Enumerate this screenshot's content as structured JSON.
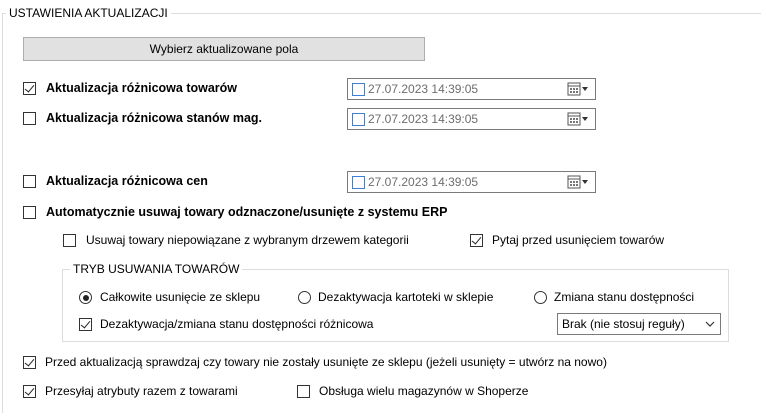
{
  "group_main": {
    "title": "USTAWIENIA AKTUALIZACJI"
  },
  "select_fields_button": "Wybierz aktualizowane pola",
  "diff_products": {
    "label": "Aktualizacja różnicowa towarów",
    "checked": true,
    "date": "27.07.2023 14:39:05"
  },
  "diff_stock": {
    "label": "Aktualizacja różnicowa stanów mag.",
    "checked": false,
    "date": "27.07.2023 14:39:05"
  },
  "diff_prices": {
    "label": "Aktualizacja różnicowa cen",
    "checked": false,
    "date": "27.07.2023 14:39:05"
  },
  "auto_remove": {
    "label": "Automatycznie usuwaj towary odznaczone/usunięte z systemu ERP",
    "checked": false
  },
  "remove_unlinked": {
    "label": "Usuwaj towary niepowiązane z wybranym drzewem kategorii",
    "checked": false
  },
  "ask_before_delete": {
    "label": "Pytaj przed usunięciem towarów",
    "checked": true
  },
  "removal_mode": {
    "title": "TRYB USUWANIA TOWARÓW",
    "options": [
      {
        "label": "Całkowite usunięcie ze sklepu",
        "selected": true
      },
      {
        "label": "Dezaktywacja kartoteki w sklepie",
        "selected": false
      },
      {
        "label": "Zmiana stanu dostępności",
        "selected": false
      }
    ],
    "diff_deactivation": {
      "label": "Dezaktywacja/zmiana stanu dostępności różnicowa",
      "checked": true
    },
    "availability_rule": {
      "value": "Brak (nie stosuj reguły)"
    }
  },
  "check_deleted": {
    "label": "Przed aktualizacją sprawdzaj czy towary nie zostały usunięte ze sklepu (jeżeli usunięty = utwórz na nowo)",
    "checked": true
  },
  "send_attributes": {
    "label": "Przesyłaj atrybuty razem z towarami",
    "checked": true
  },
  "multi_warehouse": {
    "label": "Obsługa wielu magazynów w Shoperze",
    "checked": false
  },
  "colors": {
    "dtp_checkbox_border": "#3c7fd8",
    "date_text": "#6d6d6d",
    "button_bg": "#e1e1e1"
  }
}
